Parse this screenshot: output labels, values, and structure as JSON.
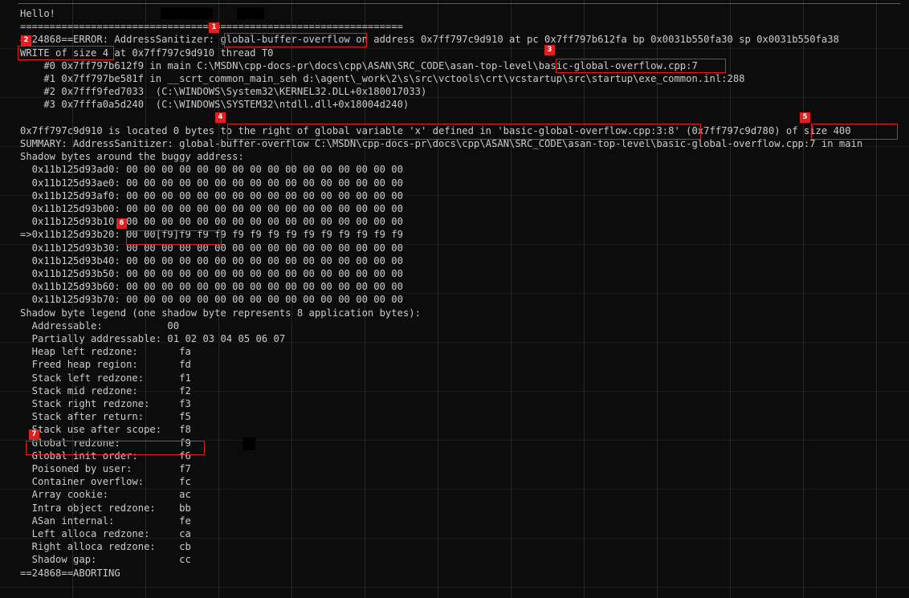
{
  "terminal": {
    "lines": [
      "Hello!",
      "=================================================================",
      "==24868==ERROR: AddressSanitizer: global-buffer-overflow on address 0x7ff797c9d910 at pc 0x7ff797b612fa bp 0x0031b550fa30 sp 0x0031b550fa38",
      "WRITE of size 4 at 0x7ff797c9d910 thread T0",
      "    #0 0x7ff797b612f9 in main C:\\MSDN\\cpp-docs-pr\\docs\\cpp\\ASAN\\SRC_CODE\\asan-top-level\\basic-global-overflow.cpp:7",
      "    #1 0x7ff797be581f in __scrt_common_main_seh d:\\agent\\_work\\2\\s\\src\\vctools\\crt\\vcstartup\\src\\startup\\exe_common.inl:288",
      "    #2 0x7fff9fed7033  (C:\\WINDOWS\\System32\\KERNEL32.DLL+0x180017033)",
      "    #3 0x7fffa0a5d240  (C:\\WINDOWS\\SYSTEM32\\ntdll.dll+0x18004d240)",
      "",
      "0x7ff797c9d910 is located 0 bytes to the right of global variable 'x' defined in 'basic-global-overflow.cpp:3:8' (0x7ff797c9d780) of size 400",
      "SUMMARY: AddressSanitizer: global-buffer-overflow C:\\MSDN\\cpp-docs-pr\\docs\\cpp\\ASAN\\SRC_CODE\\asan-top-level\\basic-global-overflow.cpp:7 in main",
      "Shadow bytes around the buggy address:",
      "  0x11b125d93ad0: 00 00 00 00 00 00 00 00 00 00 00 00 00 00 00 00",
      "  0x11b125d93ae0: 00 00 00 00 00 00 00 00 00 00 00 00 00 00 00 00",
      "  0x11b125d93af0: 00 00 00 00 00 00 00 00 00 00 00 00 00 00 00 00",
      "  0x11b125d93b00: 00 00 00 00 00 00 00 00 00 00 00 00 00 00 00 00",
      "  0x11b125d93b10: 00 00 00 00 00 00 00 00 00 00 00 00 00 00 00 00",
      "=>0x11b125d93b20: 00 00[f9]f9 f9 f9 f9 f9 f9 f9 f9 f9 f9 f9 f9 f9",
      "  0x11b125d93b30: 00 00 00 00 00 00 00 00 00 00 00 00 00 00 00 00",
      "  0x11b125d93b40: 00 00 00 00 00 00 00 00 00 00 00 00 00 00 00 00",
      "  0x11b125d93b50: 00 00 00 00 00 00 00 00 00 00 00 00 00 00 00 00",
      "  0x11b125d93b60: 00 00 00 00 00 00 00 00 00 00 00 00 00 00 00 00",
      "  0x11b125d93b70: 00 00 00 00 00 00 00 00 00 00 00 00 00 00 00 00",
      "Shadow byte legend (one shadow byte represents 8 application bytes):",
      "  Addressable:           00",
      "  Partially addressable: 01 02 03 04 05 06 07",
      "  Heap left redzone:       fa",
      "  Freed heap region:       fd",
      "  Stack left redzone:      f1",
      "  Stack mid redzone:       f2",
      "  Stack right redzone:     f3",
      "  Stack after return:      f5",
      "  Stack use after scope:   f8",
      "  Global redzone:          f9",
      "  Global init order:       f6",
      "  Poisoned by user:        f7",
      "  Container overflow:      fc",
      "  Array cookie:            ac",
      "  Intra object redzone:    bb",
      "  ASan internal:           fe",
      "  Left alloca redzone:     ca",
      "  Right alloca redzone:    cb",
      "  Shadow gap:              cc",
      "==24868==ABORTING"
    ]
  },
  "annotations": [
    {
      "label": "1"
    },
    {
      "label": "2"
    },
    {
      "label": "3"
    },
    {
      "label": "4"
    },
    {
      "label": "5"
    },
    {
      "label": "6"
    },
    {
      "label": "7"
    }
  ],
  "colors": {
    "background": "#0c0c0c",
    "text": "#cccccc",
    "annotation": "#e02020"
  }
}
